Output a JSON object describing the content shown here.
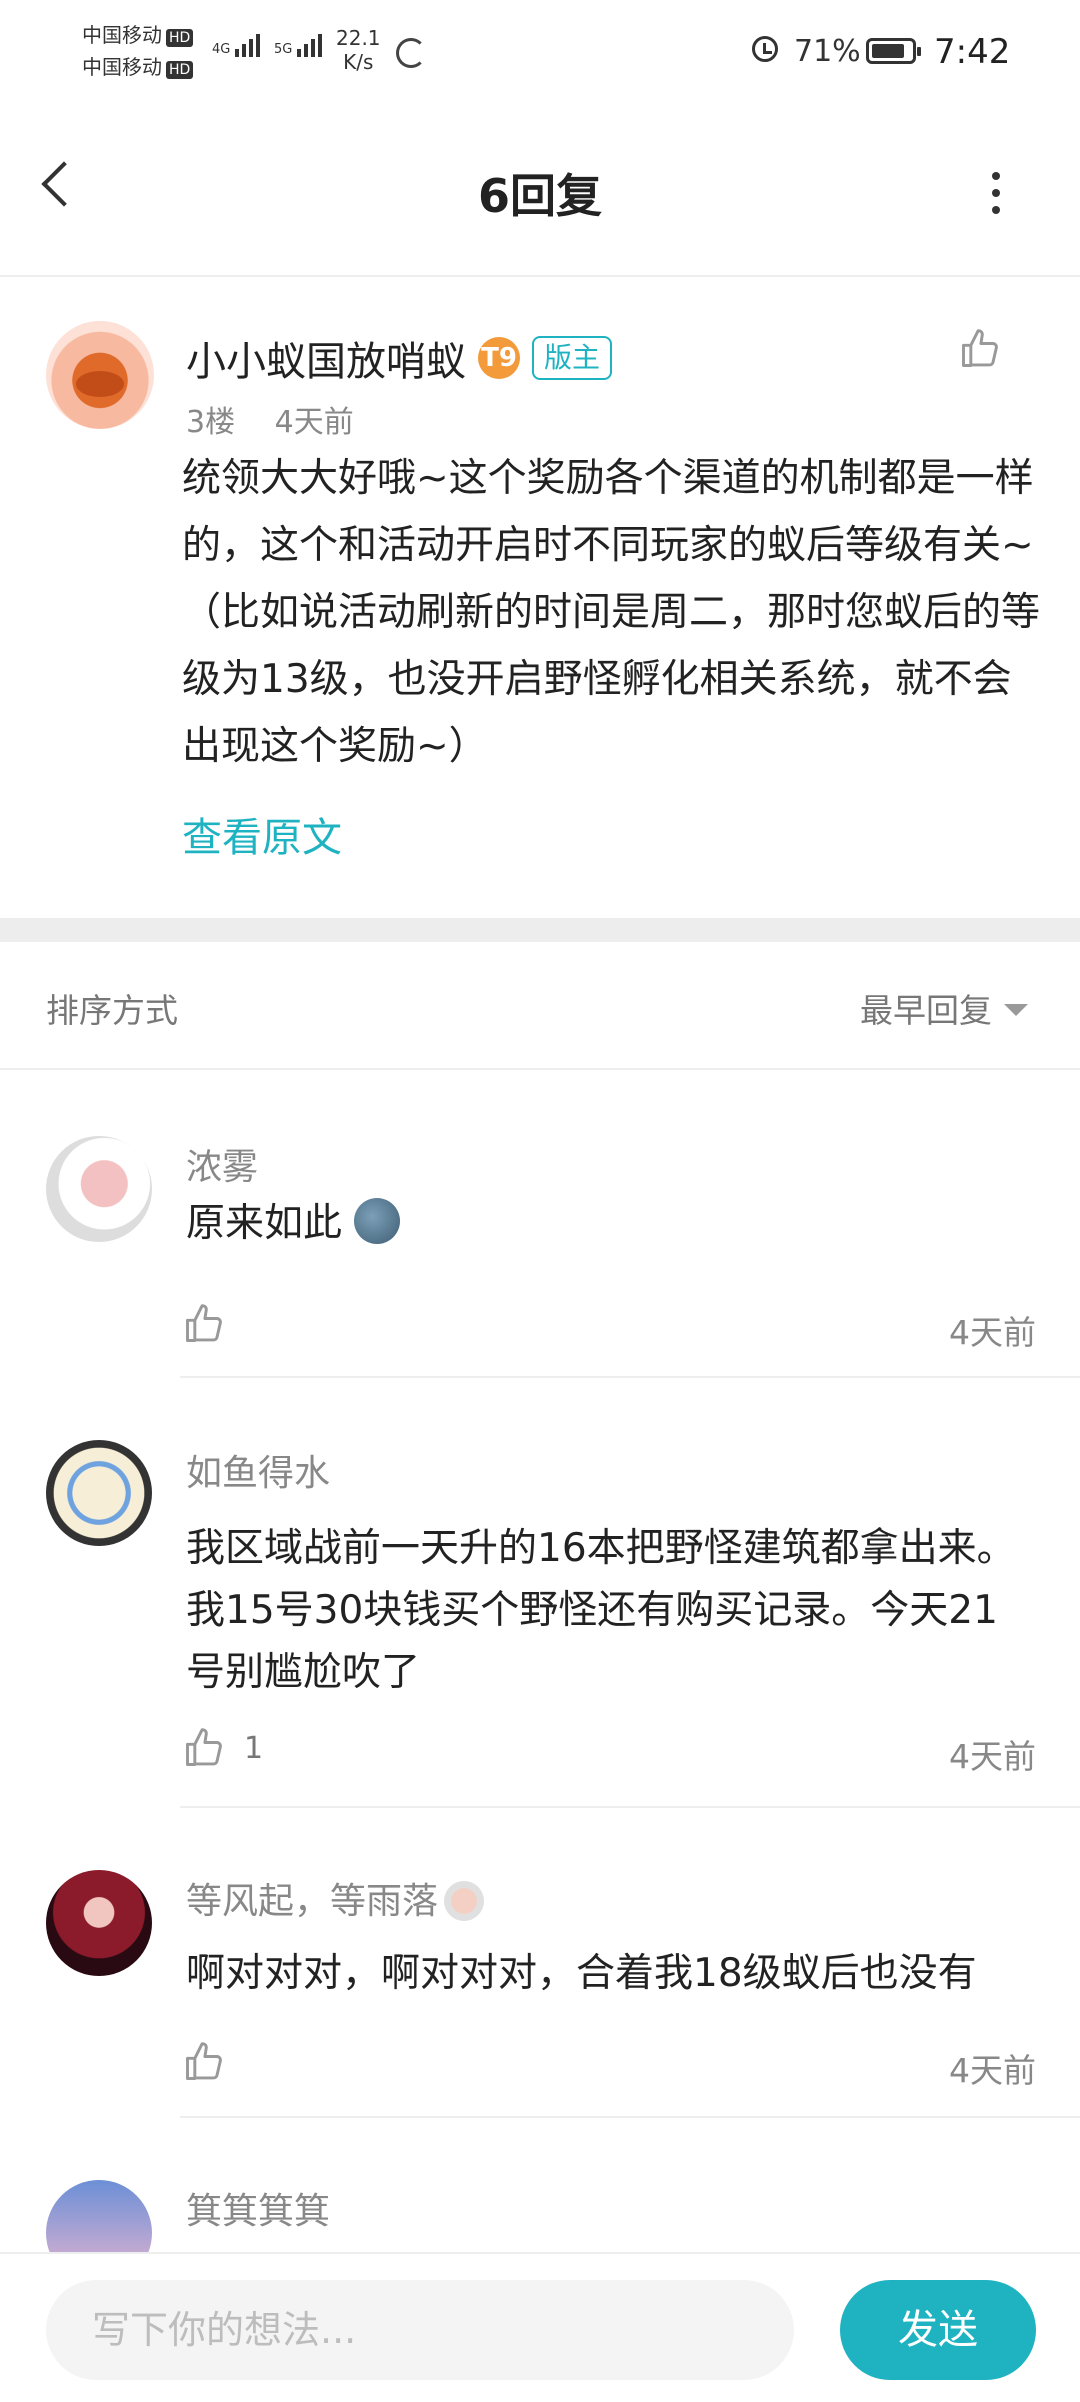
{
  "status_bar": {
    "carrier1": "中国移动",
    "carrier2": "中国移动",
    "hd": "HD",
    "sig1_label": "4G",
    "sig2_label": "5G",
    "net_speed_value": "22.1",
    "net_speed_unit": "K/s",
    "battery": "71%",
    "time": "7:42"
  },
  "header": {
    "title": "6回复"
  },
  "post": {
    "author": "小小蚁国放哨蚁",
    "level_badge": "T9",
    "mod_badge": "版主",
    "floor": "3楼",
    "time": "4天前",
    "body": "统领大大好哦~这个奖励各个渠道的机制都是一样的，这个和活动开启时不同玩家的蚁后等级有关~（比如说活动刷新的时间是周二，那时您蚁后的等级为13级，也没开启野怪孵化相关系统，就不会出现这个奖励~）",
    "view_original": "查看原文"
  },
  "sort": {
    "label": "排序方式",
    "value": "最早回复"
  },
  "replies": [
    {
      "name": "浓雾",
      "text": "原来如此",
      "likes": "",
      "time": "4天前"
    },
    {
      "name": "如鱼得水",
      "text": "我区域战前一天升的16本把野怪建筑都拿出来。我15号30块钱买个野怪还有购买记录。今天21号别尴尬吹了",
      "likes": "1",
      "time": "4天前"
    },
    {
      "name": "等风起，等雨落",
      "text": "啊对对对，啊对对对，合着我18级蚁后也没有",
      "likes": "",
      "time": "4天前"
    },
    {
      "name": "箕箕箕箕"
    }
  ],
  "composer": {
    "placeholder": "写下你的想法...",
    "send_label": "发送"
  },
  "colors": {
    "accent": "#1fb3c2",
    "level_badge": "#f39a3a"
  }
}
